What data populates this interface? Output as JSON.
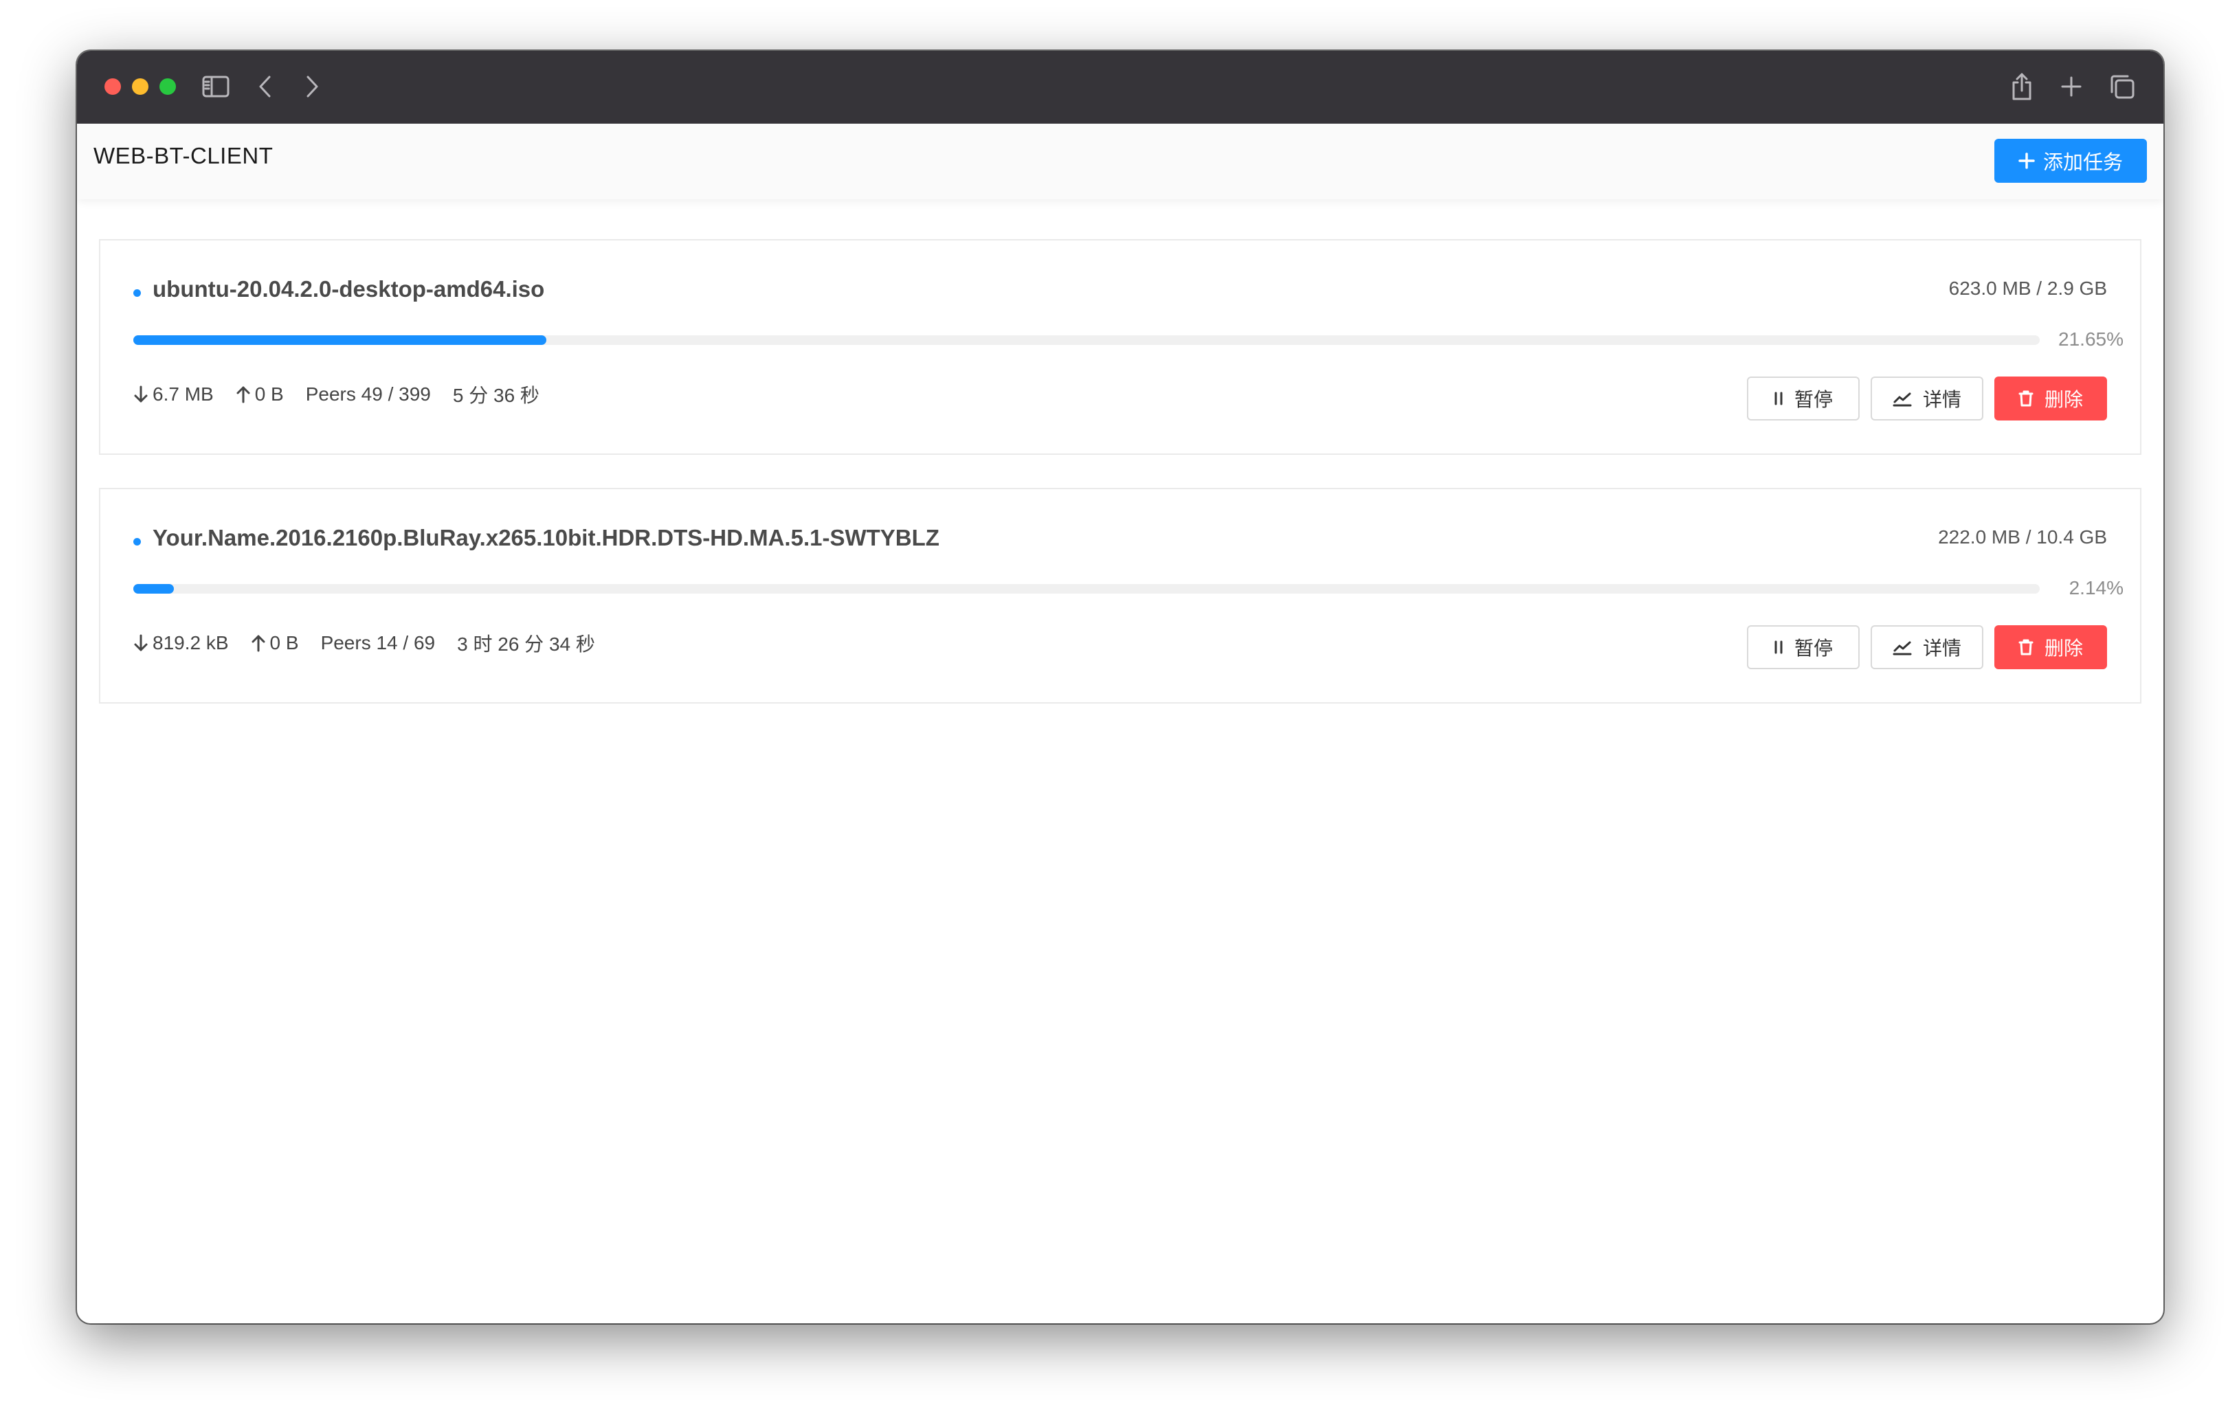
{
  "app": {
    "title": "WEB-BT-CLIENT",
    "add_task_label": "添加任务"
  },
  "icons": {
    "sidebar": "sidebar-icon",
    "back": "chevron-left-icon",
    "forward": "chevron-right-icon",
    "share": "share-icon",
    "new_tab": "plus-icon",
    "tabs": "tabs-overview-icon"
  },
  "colors": {
    "accent": "#1890ff",
    "danger": "#ff4d4f",
    "titlebar": "#363439"
  },
  "tasks": [
    {
      "name": "ubuntu-20.04.2.0-desktop-amd64.iso",
      "size": "623.0 MB / 2.9 GB",
      "progress": 0.2165,
      "progress_label": "21.65%",
      "download_speed": "6.7 MB",
      "upload_speed": "0 B",
      "peers": "Peers 49 / 399",
      "eta": "5 分 36 秒",
      "pause_label": "暂停",
      "detail_label": "详情",
      "delete_label": "删除"
    },
    {
      "name": "Your.Name.2016.2160p.BluRay.x265.10bit.HDR.DTS-HD.MA.5.1-SWTYBLZ",
      "size": "222.0 MB / 10.4 GB",
      "progress": 0.0214,
      "progress_label": "2.14%",
      "download_speed": "819.2 kB",
      "upload_speed": "0 B",
      "peers": "Peers 14 / 69",
      "eta": "3 时 26 分 34 秒",
      "pause_label": "暂停",
      "detail_label": "详情",
      "delete_label": "删除"
    }
  ]
}
